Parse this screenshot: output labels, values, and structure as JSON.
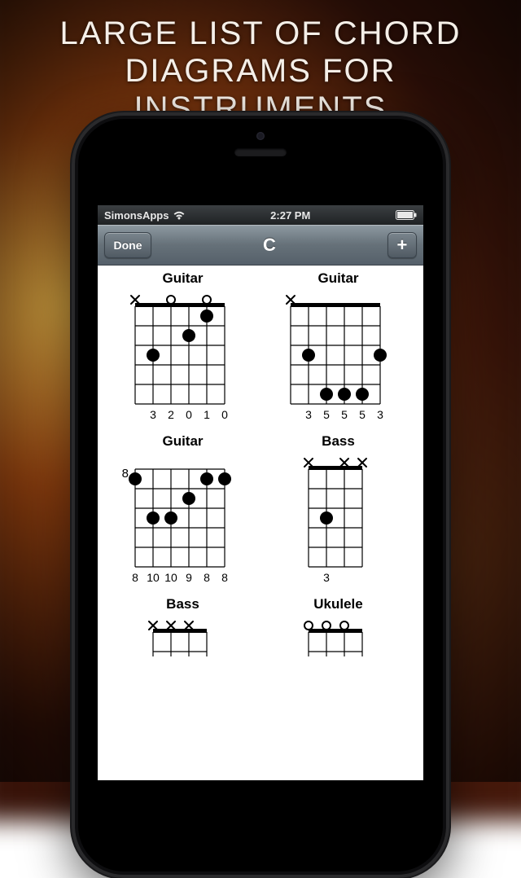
{
  "headline": "LARGE LIST OF CHORD\nDIAGRAMS FOR INSTRUMENTS",
  "statusbar": {
    "carrier": "SimonsApps",
    "time": "2:27 PM"
  },
  "navbar": {
    "done": "Done",
    "title": "C",
    "add": "+"
  },
  "chords": [
    {
      "instrument": "Guitar",
      "strings": 6,
      "fretLabel": "",
      "nut": true,
      "markers": [
        "x",
        "",
        "o",
        "",
        "o",
        ""
      ],
      "dots": [
        [
          5,
          1
        ],
        [
          4,
          2
        ],
        [
          2,
          3
        ]
      ],
      "fingers": [
        "",
        "3",
        "2",
        "0",
        "1",
        "0"
      ]
    },
    {
      "instrument": "Guitar",
      "strings": 6,
      "fretLabel": "",
      "nut": true,
      "markers": [
        "x",
        "",
        "",
        "",
        "",
        ""
      ],
      "dots": [
        [
          6,
          3
        ],
        [
          2,
          3
        ],
        [
          3,
          5
        ],
        [
          4,
          5
        ],
        [
          5,
          5
        ]
      ],
      "fingers": [
        "",
        "3",
        "5",
        "5",
        "5",
        "3"
      ]
    },
    {
      "instrument": "Guitar",
      "strings": 6,
      "fretLabel": "8",
      "nut": false,
      "markers": [
        "",
        "",
        "",
        "",
        "",
        ""
      ],
      "dots": [
        [
          1,
          1
        ],
        [
          6,
          1
        ],
        [
          5,
          1
        ],
        [
          4,
          2
        ],
        [
          2,
          3
        ],
        [
          3,
          3
        ]
      ],
      "fingers": [
        "8",
        "10",
        "10",
        "9",
        "8",
        "8"
      ]
    },
    {
      "instrument": "Bass",
      "strings": 4,
      "fretLabel": "",
      "nut": true,
      "markers": [
        "x",
        "",
        "x",
        "x"
      ],
      "dots": [
        [
          2,
          3
        ]
      ],
      "fingers": [
        "",
        "3",
        "",
        ""
      ]
    },
    {
      "instrument": "Bass",
      "strings": 4,
      "fretLabel": "",
      "nut": true,
      "markers": [
        "x",
        "x",
        "x",
        ""
      ],
      "dots": [],
      "fingers": [
        "",
        "",
        "",
        ""
      ]
    },
    {
      "instrument": "Ukulele",
      "strings": 4,
      "fretLabel": "",
      "nut": true,
      "markers": [
        "o",
        "o",
        "o",
        ""
      ],
      "dots": [],
      "fingers": [
        "",
        "",
        "",
        ""
      ]
    }
  ]
}
